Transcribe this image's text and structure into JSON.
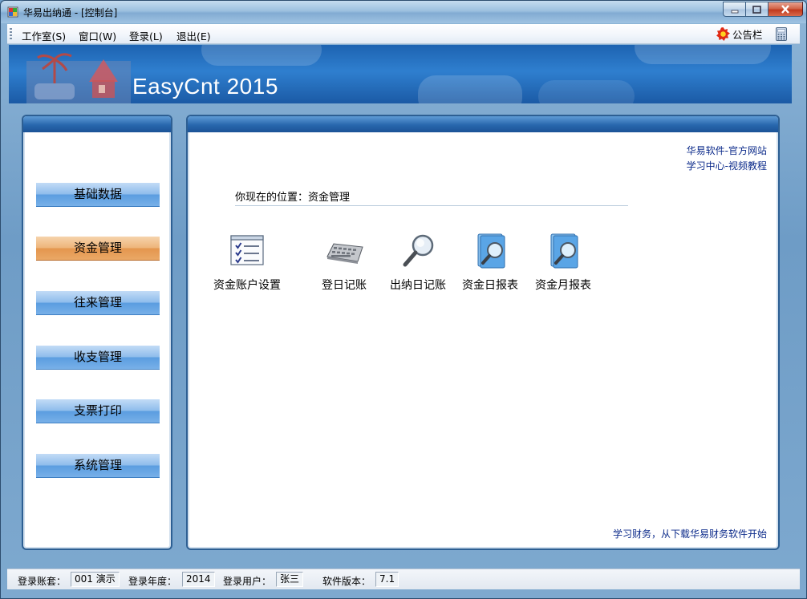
{
  "window": {
    "title": "华易出纳通 - [控制台]"
  },
  "menu": {
    "items": [
      "工作室(S)",
      "窗口(W)",
      "登录(L)",
      "退出(E)"
    ],
    "notice_label": "公告栏"
  },
  "banner": {
    "title": "EasyCnt 2015"
  },
  "nav": {
    "items": [
      "基础数据",
      "资金管理",
      "往来管理",
      "收支管理",
      "支票打印",
      "系统管理"
    ],
    "active": "资金管理"
  },
  "main": {
    "links": [
      "华易软件-官方网站",
      "学习中心-视频教程"
    ],
    "location": "你现在的位置：资金管理",
    "tools": [
      "资金账户设置",
      "登日记账",
      "出纳日记账",
      "资金日报表",
      "资金月报表"
    ],
    "footer_link": "学习财务，从下载华易财务软件开始"
  },
  "status": {
    "account_label": "登录账套：",
    "account_value": "001 演示",
    "year_label": "登录年度：",
    "year_value": "2014",
    "user_label": "登录用户：",
    "user_value": "张三",
    "version_label": "软件版本：",
    "version_value": "7.1"
  },
  "colors": {
    "nav_active": "#e4964e",
    "nav_normal": "#5b9de0",
    "link": "#0b2a8a",
    "banner": "#1d63b1"
  }
}
